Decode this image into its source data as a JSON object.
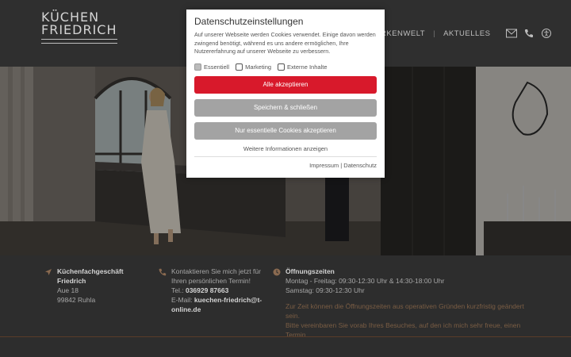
{
  "header": {
    "logo_line1": "KÜCHEN",
    "logo_line2": "FRIEDRICH",
    "nav": [
      "RKENWELT",
      "|",
      "AKTUELLES"
    ],
    "icons": [
      "mail-icon",
      "phone-icon",
      "accessibility-icon"
    ]
  },
  "hero": {
    "description": ""
  },
  "info": {
    "address_title_1": "Küchenfachgeschäft",
    "address_title_2": "Friedrich",
    "address_street": "Aue 18",
    "address_city": "99842 Ruhla",
    "contact_line1": "Kontaktieren Sie mich jetzt für",
    "contact_line2": "Ihren persönlichen Termin!",
    "tel_label": "Tel.:",
    "tel_value": "036929 87663",
    "email_label": "E-Mail:",
    "email_value": "kuechen-friedrich@t-online.de",
    "hours_title": "Öffnungszeiten",
    "hours_1": "Montag - Freitag: 09:30-12:30 Uhr & 14:30-18:00 Uhr",
    "hours_2": "Samstag: 09:30-12:30 Uhr",
    "note_1": "Zur Zeit können die Öffnungszeiten aus operativen Gründen kurzfristig geändert sein.",
    "note_2": "Bitte vereinbaren Sie vorab Ihres Besuches, auf den ich mich sehr freue, einen Termin."
  },
  "modal": {
    "title": "Datenschutzeinstellungen",
    "text": "Auf unserer Webseite werden Cookies verwendet. Einige davon werden zwingend benötigt, während es uns andere ermöglichen, Ihre Nutzererfahrung auf unserer Webseite zu verbessern.",
    "checks": [
      {
        "label": "Essentiell",
        "checked": true
      },
      {
        "label": "Marketing",
        "checked": false
      },
      {
        "label": "Externe Inhalte",
        "checked": false
      }
    ],
    "btn_accept_all": "Alle akzeptieren",
    "btn_save": "Speichern & schließen",
    "btn_essential": "Nur essentielle Cookies akzeptieren",
    "more_info": "Weitere Informationen anzeigen",
    "link_impressum": "Impressum",
    "link_sep": "|",
    "link_privacy": "Datenschutz"
  },
  "colors": {
    "accent_red": "#d8192b",
    "button_grey": "#a3a3a3",
    "icon_brown": "#8a6a50"
  }
}
